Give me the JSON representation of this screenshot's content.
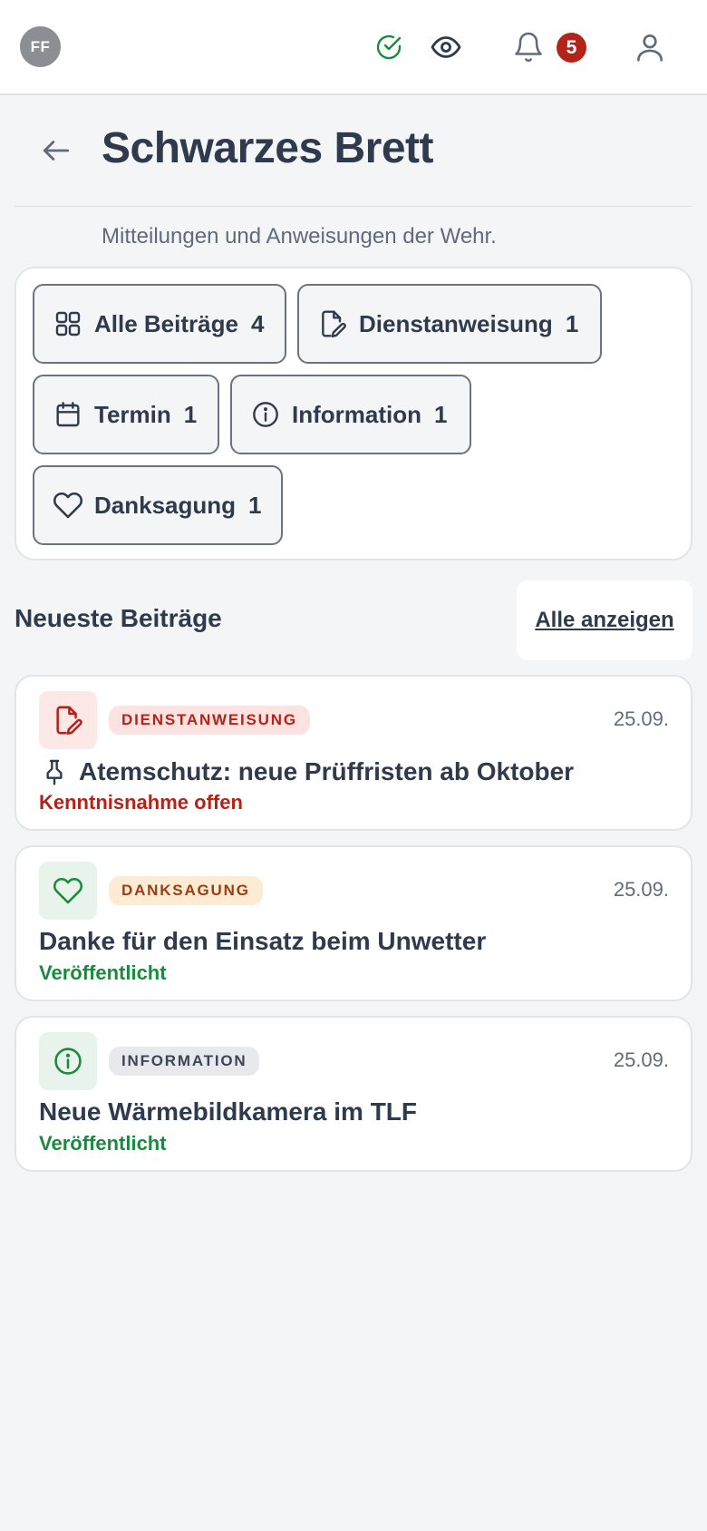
{
  "topbar": {
    "avatar_initials": "FF",
    "icons": [
      "check-circle-icon",
      "eye-icon",
      "bell-icon",
      "user-icon"
    ],
    "notification_count": "5",
    "colors": {
      "check": "#1a8a3c",
      "badge": "#b42318"
    }
  },
  "header": {
    "title": "Schwarzes Brett",
    "subtitle": "Mitteilungen und Anweisungen der Wehr."
  },
  "filters": [
    {
      "label": "Alle Beiträge",
      "count": "4",
      "icon": "grid-icon"
    },
    {
      "label": "Dienstanweisung",
      "count": "1",
      "icon": "file-edit-icon"
    },
    {
      "label": "Termin",
      "count": "1",
      "icon": "calendar-icon"
    },
    {
      "label": "Information",
      "count": "1",
      "icon": "info-icon"
    },
    {
      "label": "Danksagung",
      "count": "1",
      "icon": "heart-icon"
    }
  ],
  "latest": {
    "title": "Neueste Beiträge",
    "show_all": "Alle anzeigen"
  },
  "posts": [
    {
      "category": "DIENSTANWEISUNG",
      "date": "25.09.",
      "title": "Atemschutz: neue Prüffristen ab Oktober",
      "status": "Kenntnisnahme offen",
      "pinned": true,
      "icon": "file-edit-icon",
      "colors": {
        "icon_bg": "#fde8e8",
        "icon": "#b42318",
        "tag_bg": "#fde2e2",
        "tag_text": "#b42318",
        "status": "#b42318"
      }
    },
    {
      "category": "DANKSAGUNG",
      "date": "25.09.",
      "title": "Danke für den Einsatz beim Unwetter",
      "status": "Veröffentlicht",
      "pinned": false,
      "icon": "heart-icon",
      "colors": {
        "icon_bg": "#e8f3ec",
        "icon": "#1a8a3c",
        "tag_bg": "#fdebd3",
        "tag_text": "#9a3d12",
        "status": "#1a8a3c"
      }
    },
    {
      "category": "INFORMATION",
      "date": "25.09.",
      "title": "Neue Wärmebildkamera im TLF",
      "status": "Veröffentlicht",
      "pinned": false,
      "icon": "info-icon",
      "colors": {
        "icon_bg": "#e8f3ec",
        "icon": "#1a8a3c",
        "tag_bg": "#e7e9ec",
        "tag_text": "#3c4657",
        "status": "#1a8a3c"
      }
    }
  ]
}
